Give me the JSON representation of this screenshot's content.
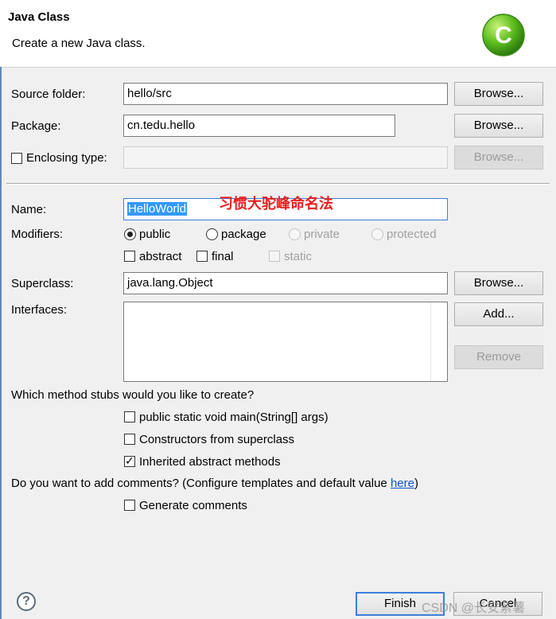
{
  "header": {
    "title": "Java Class",
    "subtitle": "Create a new Java class.",
    "logo_letter": "C"
  },
  "source_folder": {
    "label": "Source folder:",
    "value": "hello/src",
    "browse": "Browse..."
  },
  "package": {
    "label": "Package:",
    "value": "cn.tedu.hello",
    "browse": "Browse..."
  },
  "enclosing": {
    "label": "Enclosing type:",
    "value": "",
    "browse": "Browse...",
    "checked": false
  },
  "name": {
    "label": "Name:",
    "value": "HelloWorld"
  },
  "annotation": "习惯大驼峰命名法",
  "modifiers": {
    "label": "Modifiers:",
    "access": [
      {
        "label": "public",
        "selected": true,
        "enabled": true
      },
      {
        "label": "package",
        "selected": false,
        "enabled": true
      },
      {
        "label": "private",
        "selected": false,
        "enabled": false
      },
      {
        "label": "protected",
        "selected": false,
        "enabled": false
      }
    ],
    "abstract": "abstract",
    "final": "final",
    "static": "static"
  },
  "superclass": {
    "label": "Superclass:",
    "value": "java.lang.Object",
    "browse": "Browse..."
  },
  "interfaces": {
    "label": "Interfaces:",
    "add": "Add...",
    "remove": "Remove"
  },
  "stubs": {
    "question": "Which method stubs would you like to create?",
    "items": [
      {
        "label": "public static void main(String[] args)",
        "checked": false
      },
      {
        "label": "Constructors from superclass",
        "checked": false
      },
      {
        "label": "Inherited abstract methods",
        "checked": true
      }
    ]
  },
  "comments": {
    "question": "Do you want to add comments? (Configure templates and default value ",
    "link": "here",
    "question_end": ")",
    "generate": "Generate comments"
  },
  "footer": {
    "help": "?",
    "finish": "Finish",
    "cancel": "Cancel",
    "watermark": "CSDN @长安紫薯"
  }
}
